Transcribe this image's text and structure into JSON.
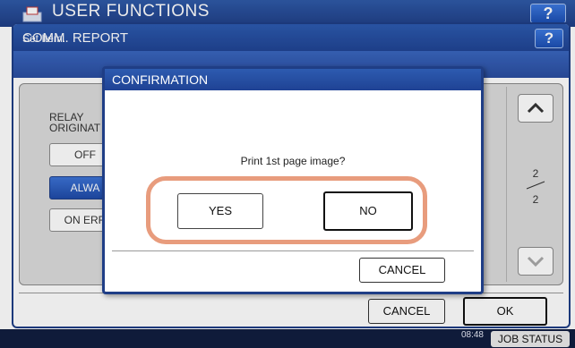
{
  "header": {
    "title": "USER FUNCTIONS",
    "help_label": "?"
  },
  "window": {
    "title": "COMM. REPORT",
    "help_label": "?",
    "subtitle": "Set Item.",
    "relay_label_line1": "RELAY",
    "relay_label_line2": "ORIGINAT",
    "options": [
      "OFF",
      "ALWA",
      "ON ERR"
    ],
    "selected_option": "ALWA",
    "page_current": "2",
    "page_total": "2",
    "cancel_label": "CANCEL",
    "ok_label": "OK"
  },
  "dialog": {
    "title": "CONFIRMATION",
    "message": "Print 1st page image?",
    "yes_label": "YES",
    "no_label": "NO",
    "cancel_label": "CANCEL"
  },
  "status_bar": {
    "time": "08:48",
    "job_status_label": "JOB STATUS"
  },
  "colors": {
    "header_blue": "#1f3e86",
    "selected_blue": "#2a5ab8",
    "highlight_orange": "#e89c7d"
  }
}
